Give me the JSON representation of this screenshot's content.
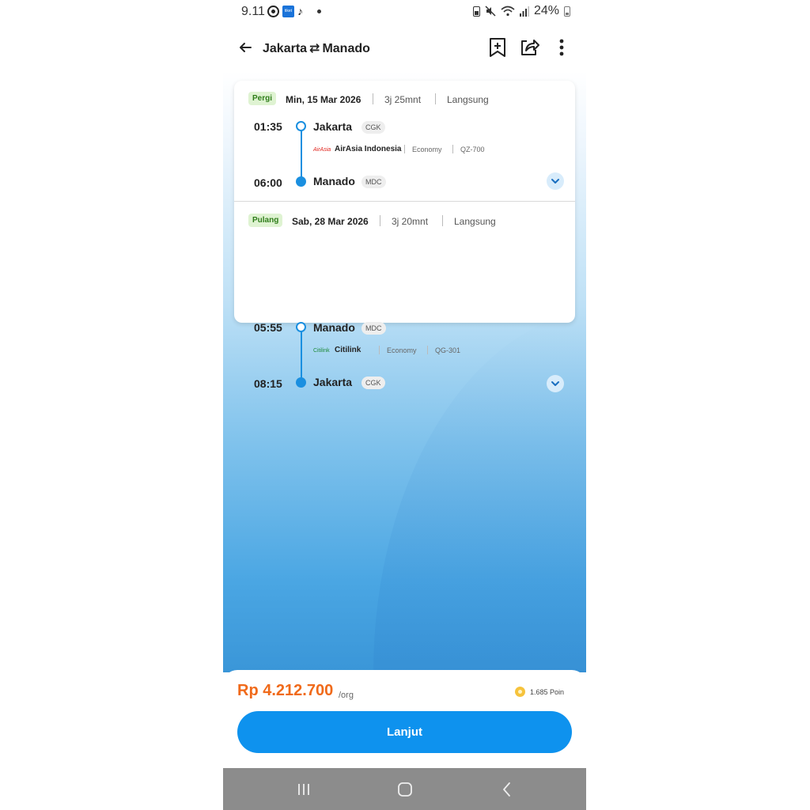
{
  "status_bar": {
    "time": "9.11",
    "battery": "24%",
    "left_icons": [
      "threads-icon",
      "tiket-app-icon",
      "tiktok-icon",
      "dot-icon"
    ],
    "right_icons": [
      "battery-saver-icon",
      "mute-icon",
      "wifi-icon",
      "signal-icon",
      "battery-icon"
    ]
  },
  "header": {
    "origin": "Jakarta",
    "swap_symbol": "⇄",
    "destination": "Manado",
    "icons": [
      "back-arrow-icon",
      "bookmark-add-icon",
      "share-icon",
      "more-vert-icon"
    ]
  },
  "itinerary": [
    {
      "tag": "Pergi",
      "date": "Min, 15 Mar 2026",
      "duration": "3j 25mnt",
      "type": "Langsung",
      "depart_time": "01:35",
      "depart_city": "Jakarta",
      "depart_code": "CGK",
      "airline_logo": "AirAsia",
      "airline": "AirAsia Indonesia",
      "cabin": "Economy",
      "flight_no": "QZ-700",
      "arrive_time": "06:00",
      "arrive_city": "Manado",
      "arrive_code": "MDC"
    },
    {
      "tag": "Pulang",
      "date": "Sab, 28 Mar 2026",
      "duration": "3j 20mnt",
      "type": "Langsung",
      "depart_time": "05:55",
      "depart_city": "Manado",
      "depart_code": "MDC",
      "airline_logo": "Citilink",
      "airline": "Citilink",
      "cabin": "Economy",
      "flight_no": "QG-301",
      "arrive_time": "08:15",
      "arrive_city": "Jakarta",
      "arrive_code": "CGK"
    }
  ],
  "footer": {
    "price": "Rp 4.212.700",
    "per": "/org",
    "points": "1.685 Poin",
    "button": "Lanjut"
  },
  "colors": {
    "primary": "#0e92ee",
    "price": "#f06a1a",
    "tag_bg": "#dff3d2",
    "tag_text": "#2f7d1a"
  }
}
